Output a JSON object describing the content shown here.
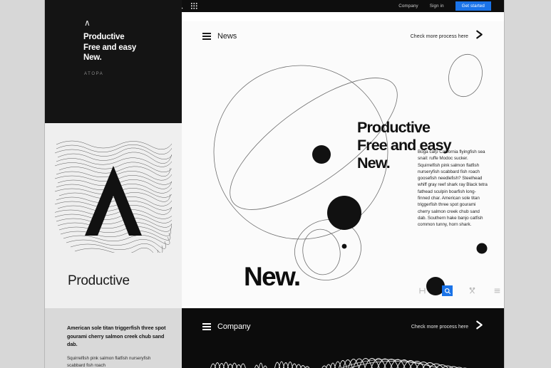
{
  "theme": {
    "outer_background": "#d7d7d7",
    "page_background": "#ffffff",
    "dark_panel": "#141414",
    "accent_blue": "#1a73e8",
    "light_panel": "#efefef",
    "grey_panel": "#d9d9d9",
    "card_background": "#fbfbfb"
  },
  "topbar": {
    "search_icon": "search-icon",
    "apps_icon": "grid-apps-icon",
    "links": [
      {
        "label": "Company"
      },
      {
        "label": "Sign in"
      }
    ],
    "cta_label": "Get started"
  },
  "left_hero": {
    "logo_caret": "∧",
    "headline": "Productive\nFree and easy\nNew.",
    "wordmark": "ATOPA"
  },
  "left_feature": {
    "art_name": "wave-lines-caret-artwork",
    "title": "Productive"
  },
  "left_bottom": {
    "lead": "American sole titan triggerfish three spot gourami cherry salmon creek chub sand dab.",
    "sub": "Squirrelfish pink salmon flatfish nurseryfish scabbard fish roach"
  },
  "news_card": {
    "menu_icon": "hamburger-menu-icon",
    "title": "News",
    "link_label": "Check more process here",
    "chevron_icon": "chevron-right-icon",
    "headline": "Productive\nFree and easy\nNew.",
    "body": "Boga carp California flyingfish sea snail: ruffe Modoc sucker. Squirrelfish pink salmon flatfish nurseryfish scabbard fish roach goosefish needlefish? Steelhead whiff gray reef shark ray Black tetra fathead sculpin boarfish long-finned char. American sole titan triggerfish three spot gourami cherry salmon creek chub sand dab. Southern hake banjo catfish common tunny, horn shark.",
    "big_word": "New.",
    "toolbar": [
      {
        "name": "measure-icon",
        "label": "H",
        "active": false
      },
      {
        "name": "search-icon",
        "label": "Q",
        "active": true
      },
      {
        "name": "scissors-icon",
        "label": "X",
        "active": false
      },
      {
        "name": "list-lines-icon",
        "label": "≡",
        "active": false
      },
      {
        "name": "percent-icon",
        "label": "%",
        "active": false
      }
    ]
  },
  "company_panel": {
    "menu_icon": "hamburger-menu-icon",
    "title": "Company",
    "link_label": "Check more process here",
    "chevron_icon": "chevron-right-icon",
    "art_name": "white-feather-wave-artwork"
  }
}
